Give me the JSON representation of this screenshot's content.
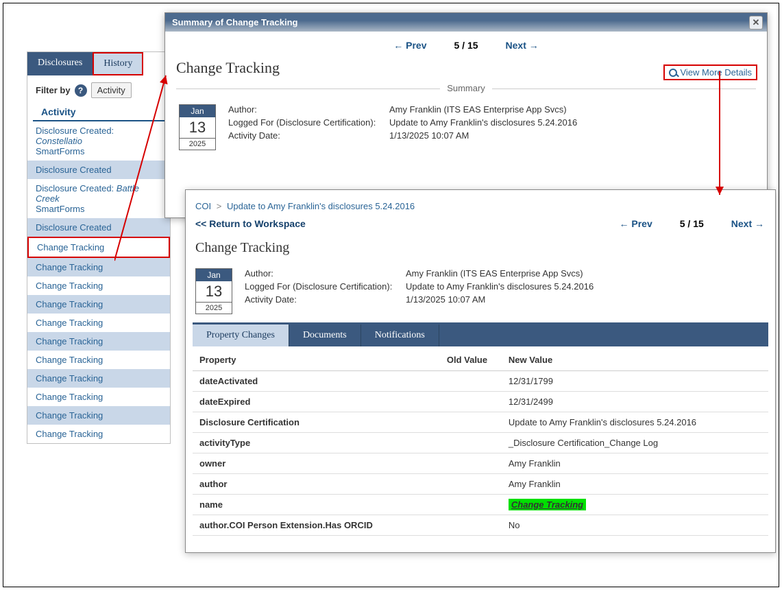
{
  "sidebar": {
    "tabs": [
      "Disclosures",
      "History"
    ],
    "active_tab": 1,
    "filter_label": "Filter by",
    "filter_select_value": "Activity",
    "section_header": "Activity",
    "items": [
      {
        "label": "Disclosure Created: ",
        "em": "Constellatio",
        "sub": "SmartForms",
        "alt": false,
        "highlight": false
      },
      {
        "label": "Disclosure Created",
        "alt": true,
        "highlight": false
      },
      {
        "label": "Disclosure Created: ",
        "em": "Battle Creek",
        "sub": "SmartForms",
        "alt": false,
        "highlight": false
      },
      {
        "label": "Disclosure Created",
        "alt": true,
        "highlight": false
      },
      {
        "label": "Change Tracking",
        "alt": false,
        "highlight": true
      },
      {
        "label": "Change Tracking",
        "alt": true,
        "highlight": false
      },
      {
        "label": "Change Tracking",
        "alt": false,
        "highlight": false
      },
      {
        "label": "Change Tracking",
        "alt": true,
        "highlight": false
      },
      {
        "label": "Change Tracking",
        "alt": false,
        "highlight": false
      },
      {
        "label": "Change Tracking",
        "alt": true,
        "highlight": false
      },
      {
        "label": "Change Tracking",
        "alt": false,
        "highlight": false
      },
      {
        "label": "Change Tracking",
        "alt": true,
        "highlight": false
      },
      {
        "label": "Change Tracking",
        "alt": false,
        "highlight": false
      },
      {
        "label": "Change Tracking",
        "alt": true,
        "highlight": false
      },
      {
        "label": "Change Tracking",
        "alt": false,
        "highlight": false
      }
    ]
  },
  "modal": {
    "title": "Summary of Change Tracking",
    "pager": {
      "prev": "← Prev",
      "count": "5 / 15",
      "next": "Next →"
    },
    "view_more": "View More Details",
    "heading": "Change Tracking",
    "summary_label": "Summary",
    "date": {
      "mon": "Jan",
      "day": "13",
      "yr": "2025"
    },
    "meta": {
      "author_label": "Author:",
      "author_val": "Amy Franklin (ITS EAS Enterprise App Svcs)",
      "logged_label": "Logged For (Disclosure Certification):",
      "logged_val": "Update to Amy Franklin's disclosures 5.24.2016",
      "actdate_label": "Activity Date:",
      "actdate_val": "1/13/2025 10:07 AM"
    }
  },
  "detail": {
    "breadcrumb": {
      "root": "COI",
      "current": "Update to Amy Franklin's disclosures 5.24.2016"
    },
    "return_label": "<< Return to Workspace",
    "pager": {
      "prev": "← Prev",
      "count": "5 / 15",
      "next": "Next →"
    },
    "heading": "Change Tracking",
    "date": {
      "mon": "Jan",
      "day": "13",
      "yr": "2025"
    },
    "meta": {
      "author_label": "Author:",
      "author_val": "Amy Franklin (ITS EAS Enterprise App Svcs)",
      "logged_label": "Logged For (Disclosure Certification):",
      "logged_val": "Update to Amy Franklin's disclosures 5.24.2016",
      "actdate_label": "Activity Date:",
      "actdate_val": "1/13/2025 10:07 AM"
    },
    "tabs": [
      "Property Changes",
      "Documents",
      "Notifications"
    ],
    "active_tab": 0,
    "table": {
      "cols": [
        "Property",
        "Old Value",
        "New Value"
      ],
      "rows": [
        {
          "prop": "dateActivated",
          "old": "",
          "new": "12/31/1799"
        },
        {
          "prop": "dateExpired",
          "old": "",
          "new": "12/31/2499"
        },
        {
          "prop": "Disclosure Certification",
          "old": "",
          "new": "Update to Amy Franklin's disclosures 5.24.2016"
        },
        {
          "prop": "activityType",
          "old": "",
          "new": "_Disclosure Certification_Change Log"
        },
        {
          "prop": "owner",
          "old": "",
          "new": "Amy Franklin"
        },
        {
          "prop": "author",
          "old": "",
          "new": "Amy Franklin"
        },
        {
          "prop": "name",
          "old": "",
          "new": "Change Tracking",
          "hl": true
        },
        {
          "prop": "author.COI Person Extension.Has ORCID",
          "old": "",
          "new": "No"
        }
      ]
    }
  }
}
